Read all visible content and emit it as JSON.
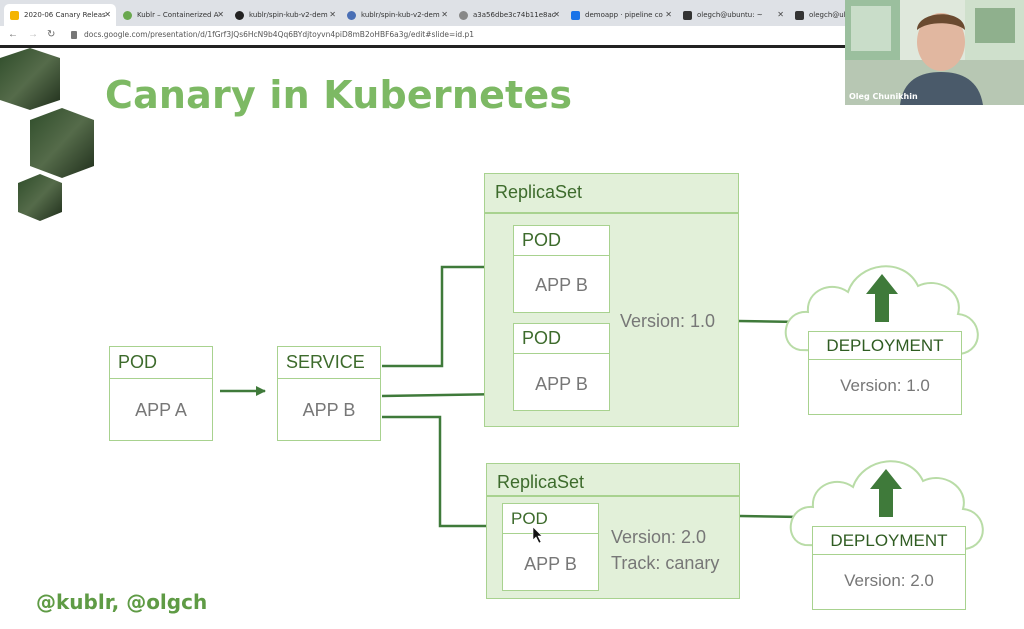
{
  "browser": {
    "tabs": [
      {
        "label": "2020-06 Canary Releas",
        "active": true,
        "favicon_color": "#f4b400"
      },
      {
        "label": "Kublr – Containerized A",
        "active": false,
        "favicon_color": "#6aa84f"
      },
      {
        "label": "kublr/spin-kub-v2-dem",
        "active": false,
        "favicon_color": "#222222"
      },
      {
        "label": "kublr/spin-kub-v2-dem",
        "active": false,
        "favicon_color": "#4a6fb5"
      },
      {
        "label": "a3a56dbe3c74b11e8ac",
        "active": false,
        "favicon_color": "#888888"
      },
      {
        "label": "demoapp · pipeline co",
        "active": false,
        "favicon_color": "#1a73e8"
      },
      {
        "label": "olegch@ubuntu: ~",
        "active": false,
        "favicon_color": "#333333"
      },
      {
        "label": "olegch@ubu",
        "active": false,
        "favicon_color": "#333333"
      }
    ],
    "url": "docs.google.com/presentation/d/1fGrf3JQs6HcN9b4Qq6BYdjtoyvn4piD8mB2oHBF6a3g/edit#slide=id.p1"
  },
  "slide": {
    "title": "Canary in Kubernetes",
    "handle": "@kublr, @olgch",
    "pod_a": {
      "header": "POD",
      "body": "APP A"
    },
    "service": {
      "header": "SERVICE",
      "body": "APP B"
    },
    "replicaset_1": {
      "title": "ReplicaSet",
      "pods": [
        {
          "header": "POD",
          "body": "APP B"
        },
        {
          "header": "POD",
          "body": "APP B"
        }
      ],
      "version": "Version: 1.0"
    },
    "replicaset_2": {
      "title": "ReplicaSet",
      "pod": {
        "header": "POD",
        "body": "APP B"
      },
      "version": "Version: 2.0",
      "track": "Track: canary"
    },
    "deployment_1": {
      "header": "DEPLOYMENT",
      "version": "Version: 1.0"
    },
    "deployment_2": {
      "header": "DEPLOYMENT",
      "version": "Version: 2.0"
    },
    "accent_color": "#7db964",
    "arrow_color": "#3f7a3a"
  },
  "webcam": {
    "name": "Oleg Chunikhin"
  }
}
